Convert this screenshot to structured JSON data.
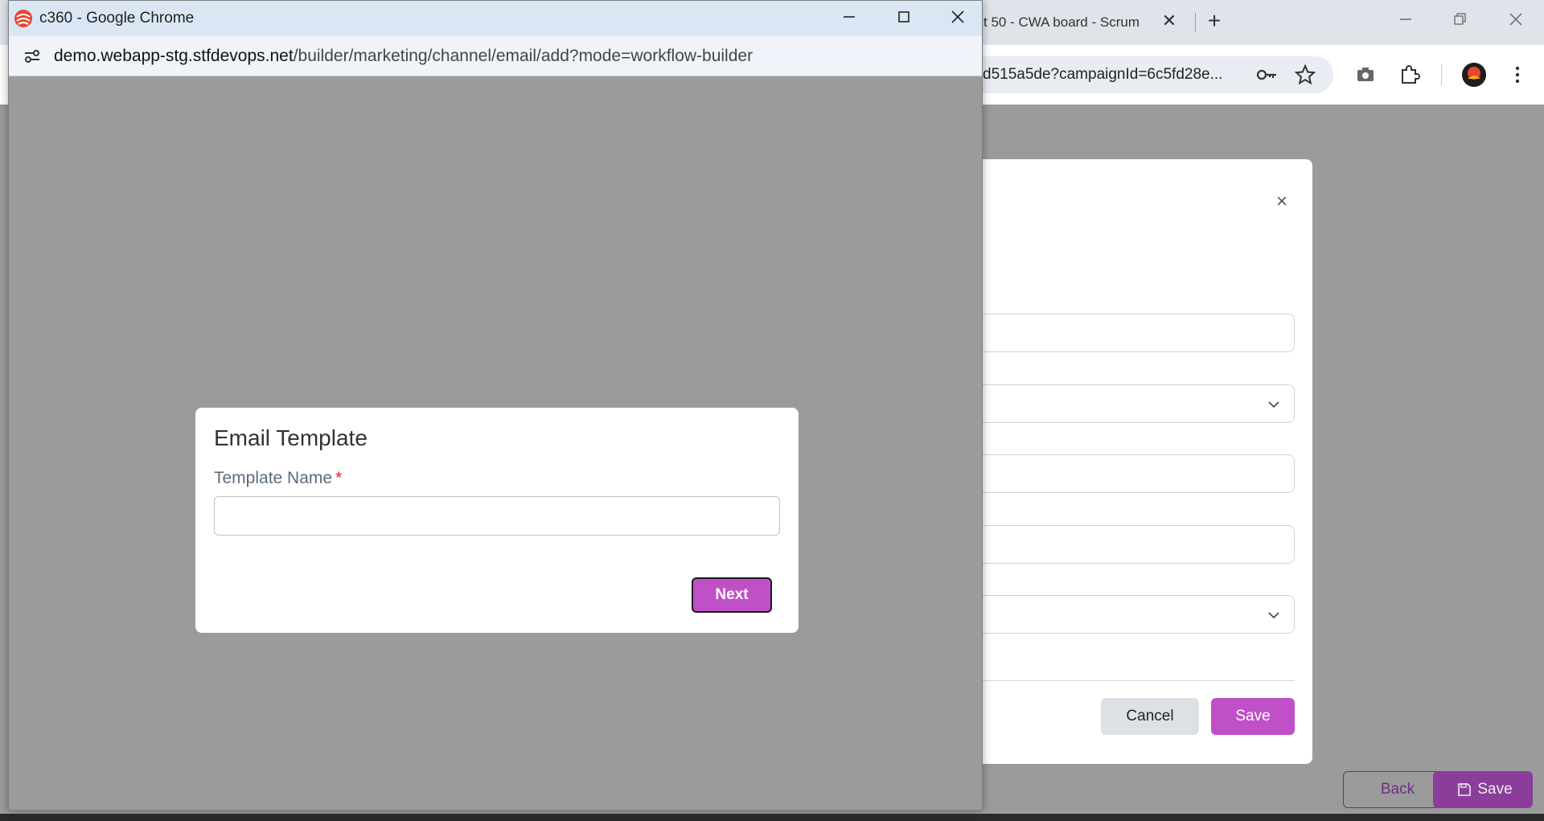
{
  "background_browser": {
    "tab_label": "t 50 - CWA board - Scrum",
    "tab_close": "✕",
    "new_tab": "+",
    "url_fragment": "d515a5de?campaignId=6c5fd28e...",
    "modal": {
      "close_glyph": "×",
      "cancel_label": "Cancel",
      "save_label": "Save"
    },
    "page_buttons": {
      "back_label": "Back",
      "save_label": "Save"
    },
    "icons": [
      "key-icon",
      "star-icon",
      "camera-icon",
      "extensions-icon",
      "profile-avatar",
      "more-menu-icon"
    ]
  },
  "popup": {
    "window_title": "c360 - Google Chrome",
    "url_host": "demo.webapp-stg.stfdevops.net",
    "url_path": "/builder/marketing/channel/email/add?mode=workflow-builder",
    "dialog": {
      "title": "Email Template",
      "field_label": "Template Name",
      "required_marker": "*",
      "input_value": "",
      "next_label": "Next"
    }
  },
  "colors": {
    "accent": "#c050c8",
    "accent_dark": "#8a3d9a",
    "overlay": "#9b9b9b",
    "titlebar": "#dbe6f5"
  }
}
